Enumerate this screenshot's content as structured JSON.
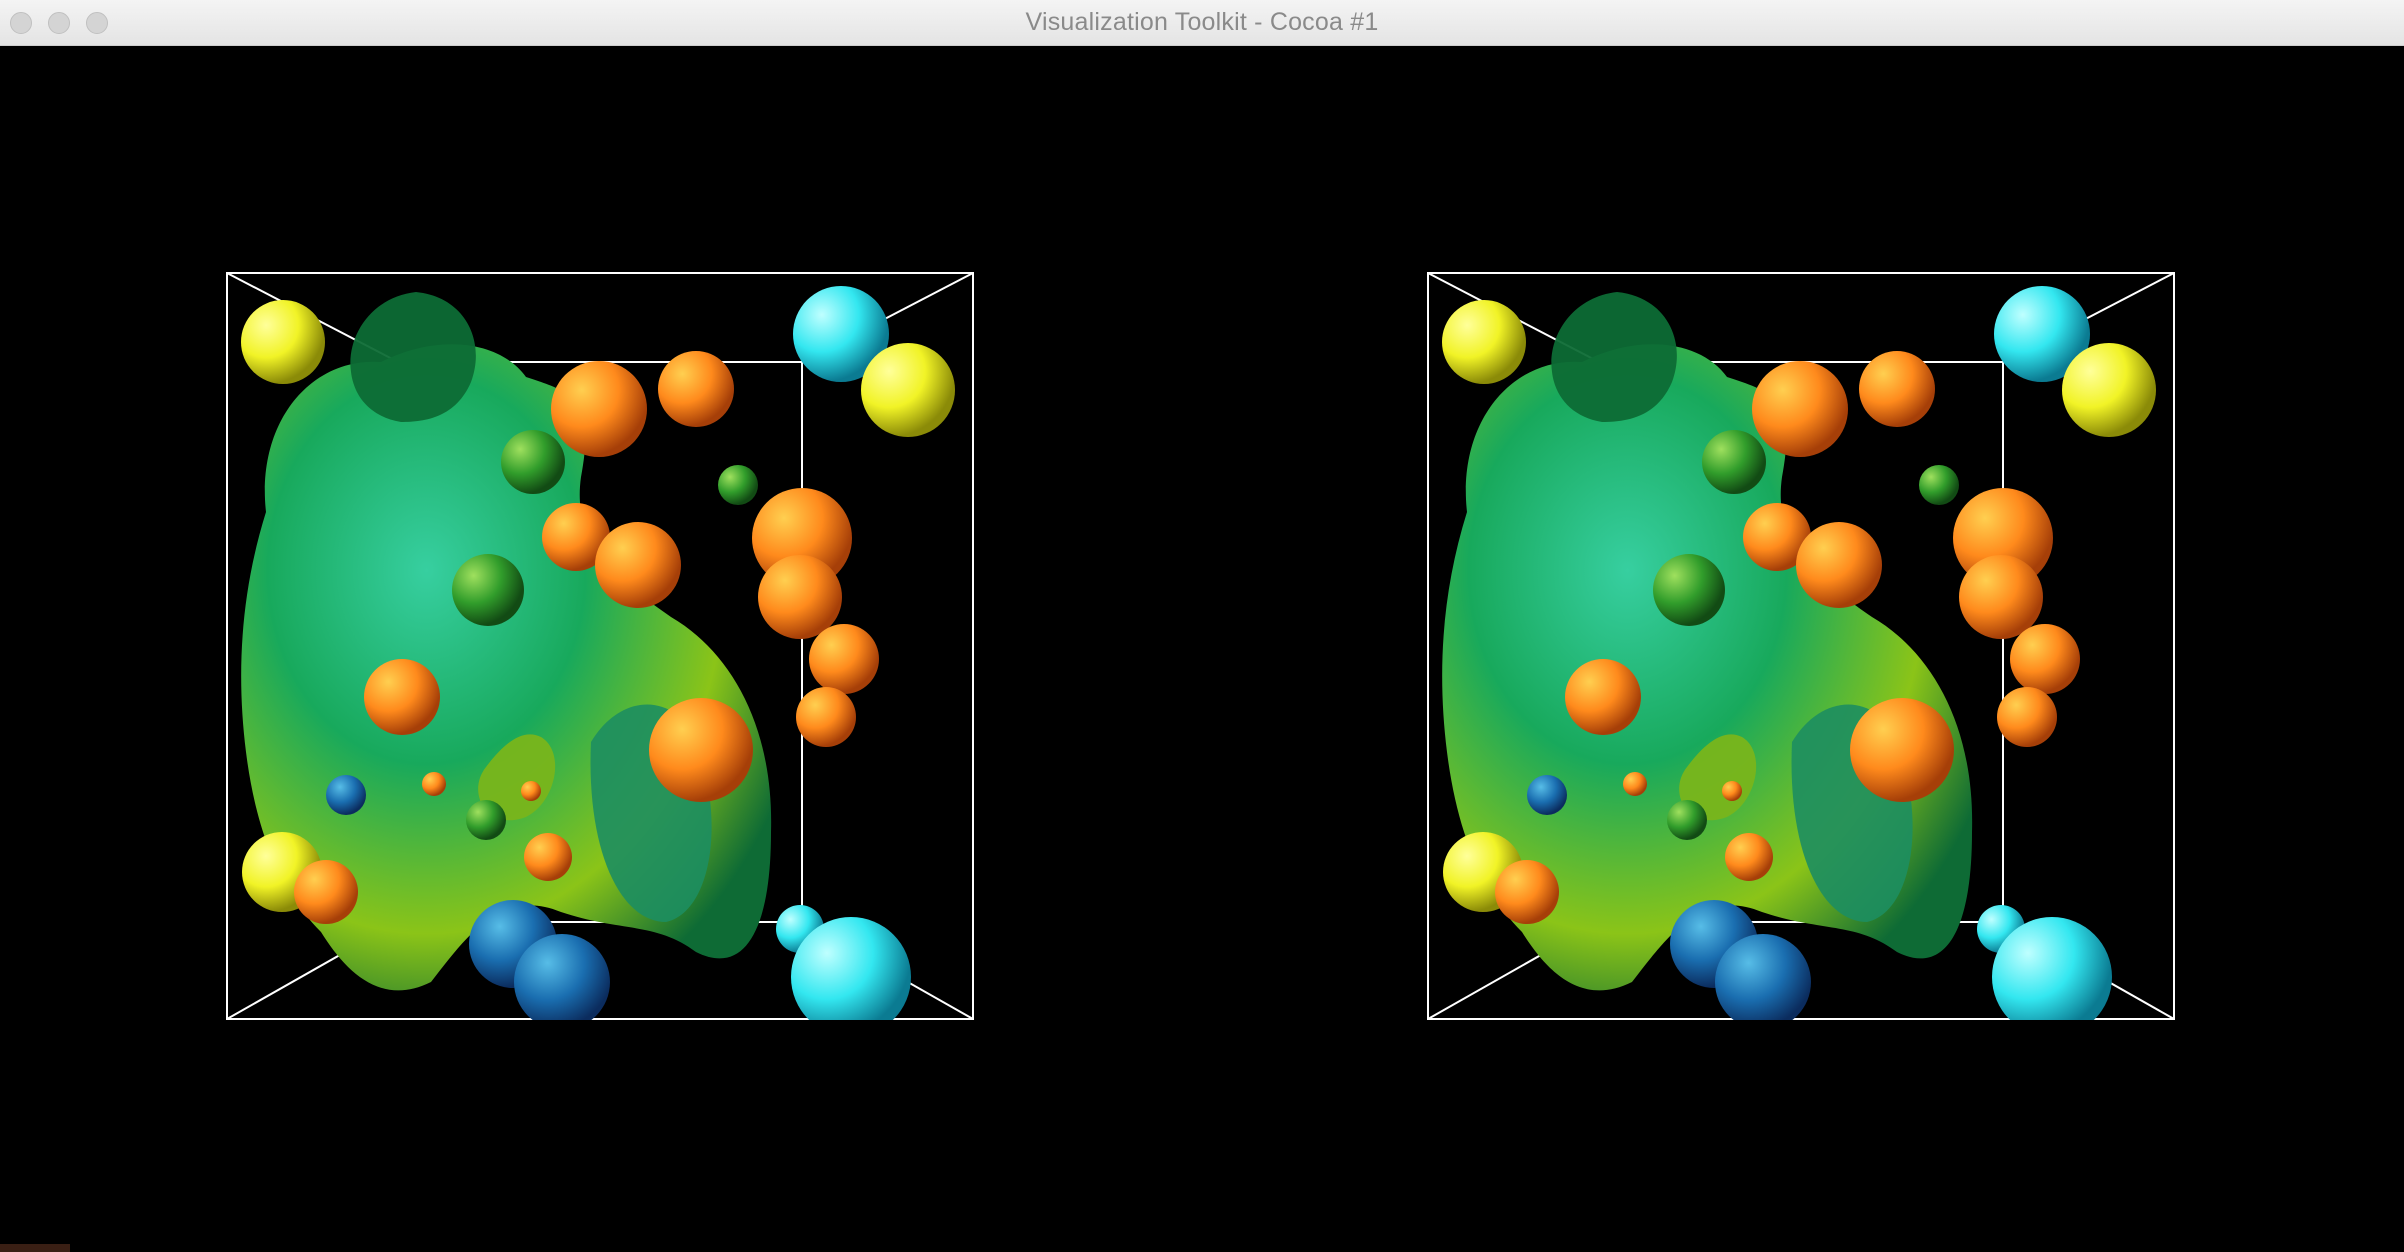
{
  "window": {
    "title": "Visualization Toolkit - Cocoa #1",
    "controls": [
      "close",
      "minimize",
      "zoom"
    ]
  },
  "scene": {
    "background_color": "#000000",
    "outline_color": "#ffffff",
    "views": [
      {
        "name": "left-stereo-view"
      },
      {
        "name": "right-stereo-view"
      }
    ],
    "palette": {
      "surface_dark": "#064f2d",
      "surface_mid": "#109a4a",
      "surface_light": "#37cfa0",
      "surface_yellowgreen": "#8bc418",
      "orange": "#ff8a1c",
      "yellow": "#f1f326",
      "cyan": "#33e7f0",
      "blue": "#1a6eb0"
    }
  }
}
